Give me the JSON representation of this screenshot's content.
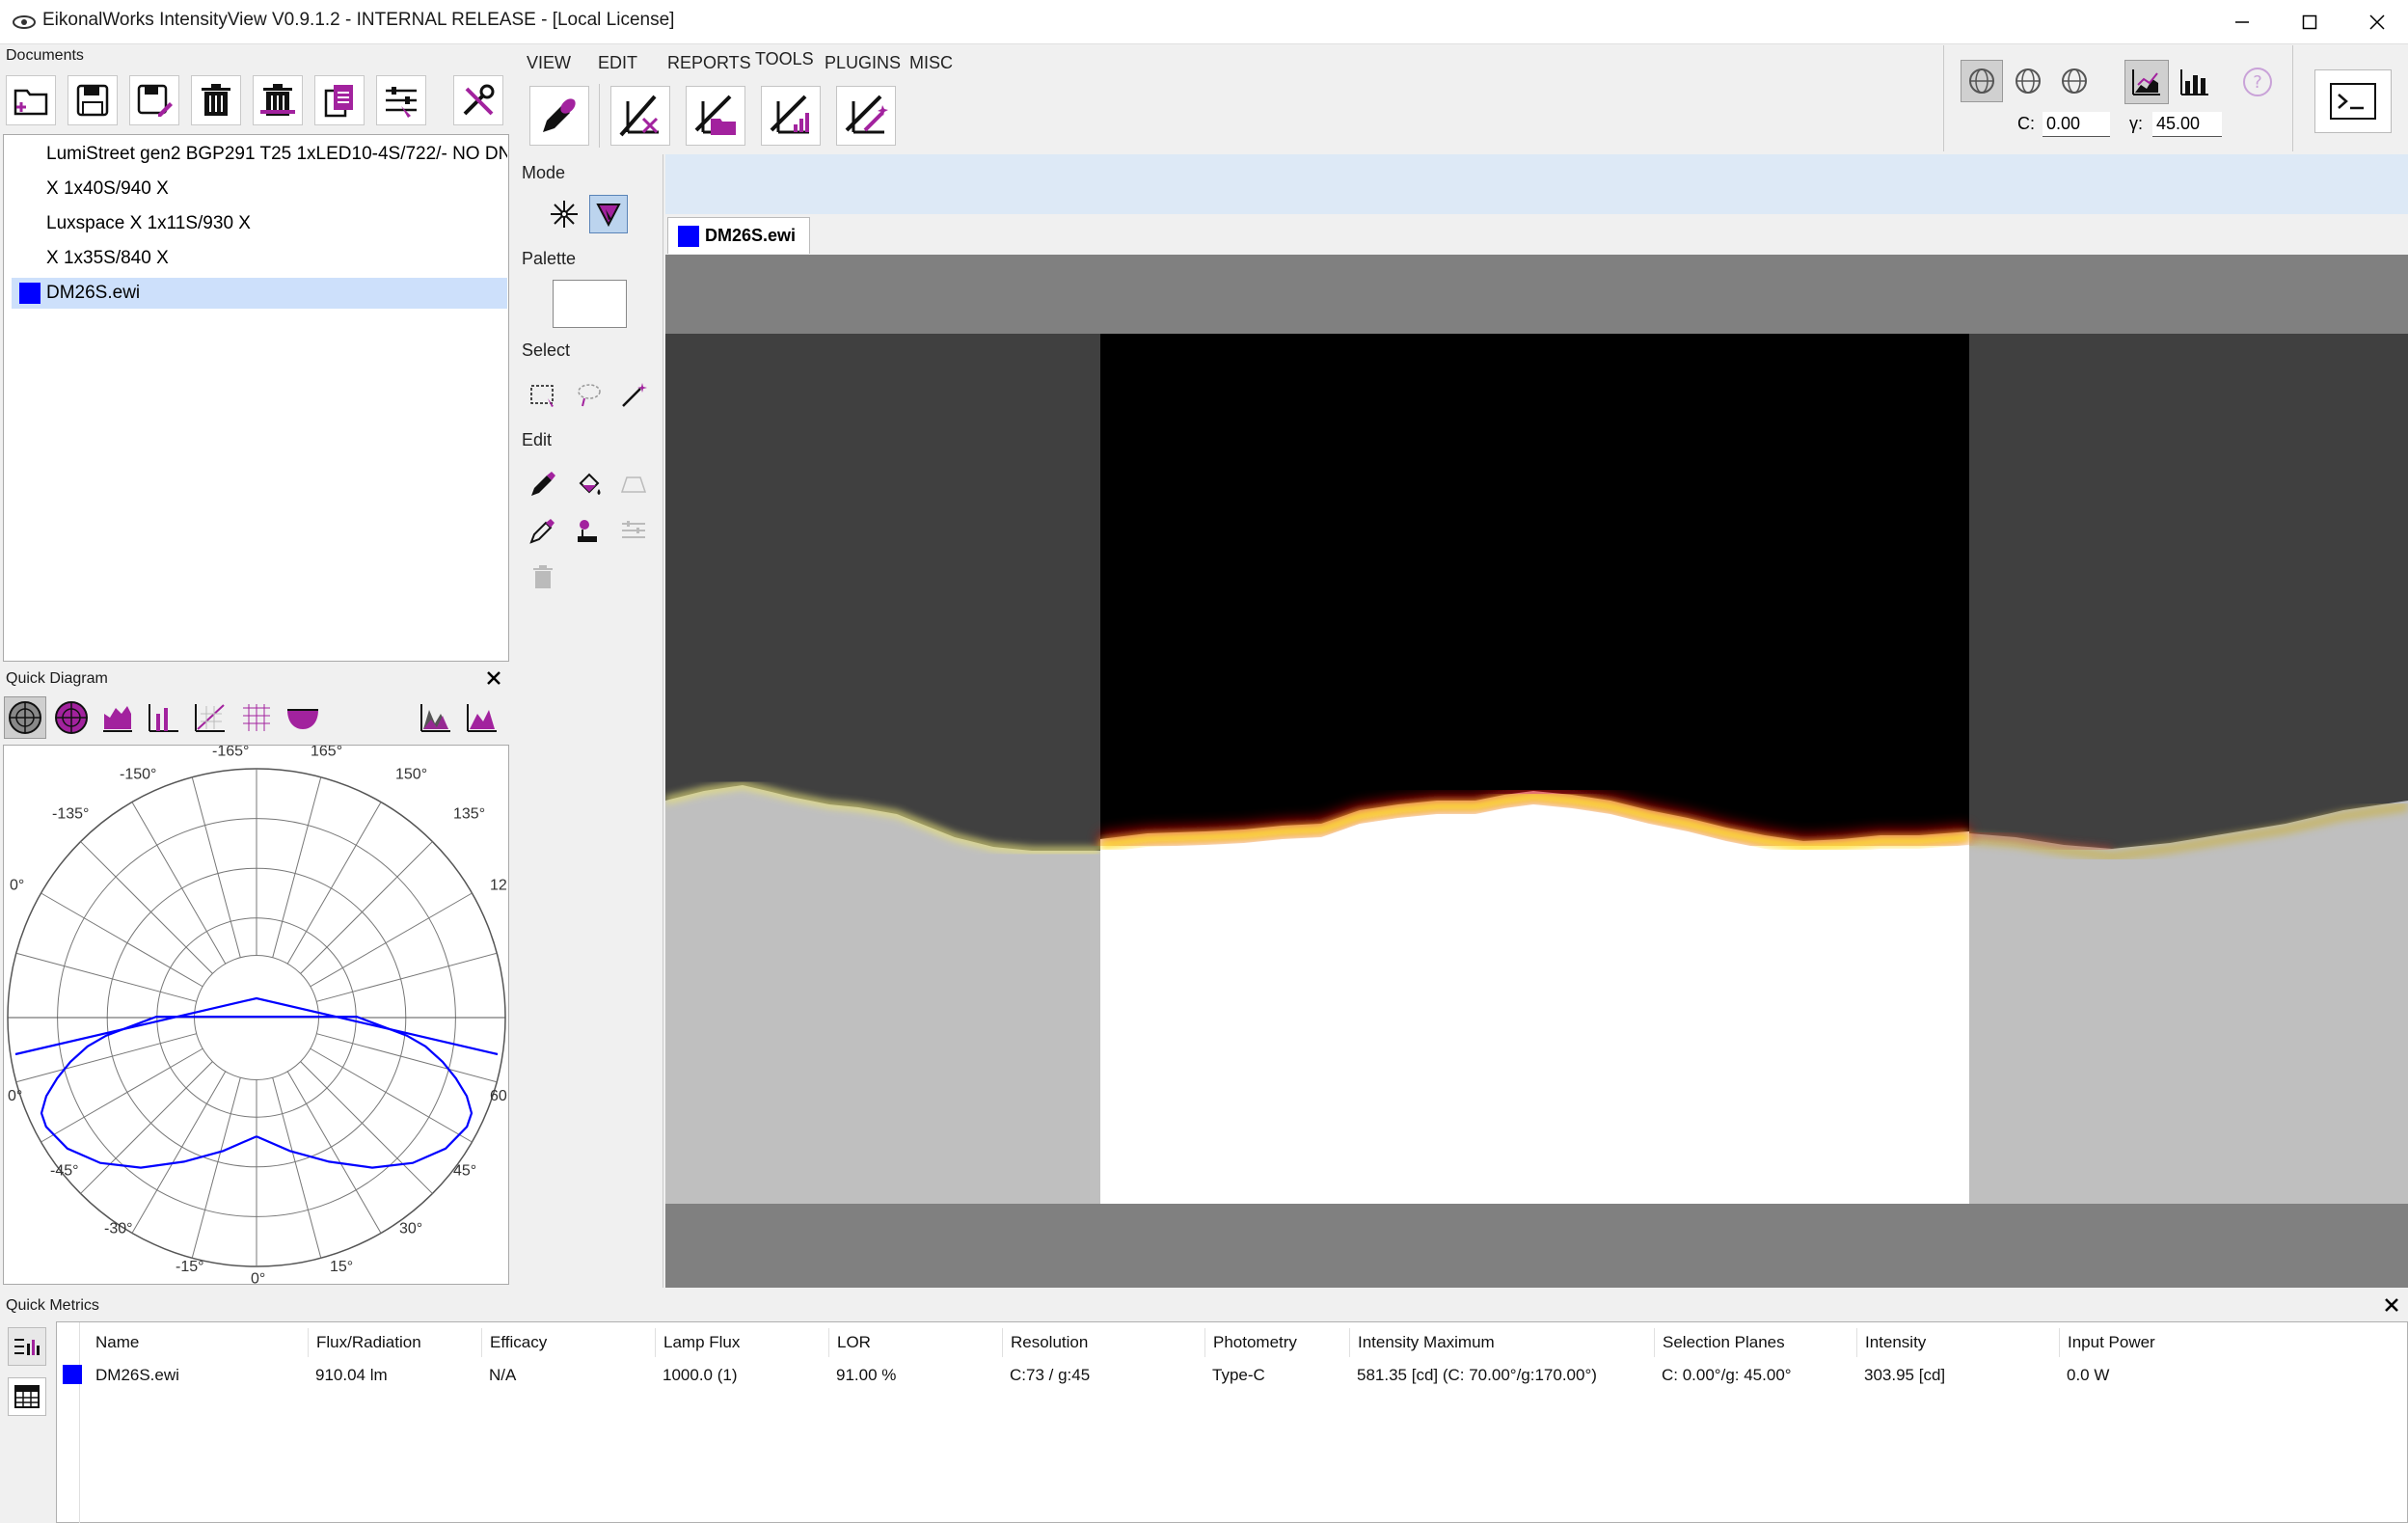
{
  "window": {
    "title": "EikonalWorks IntensityView V0.9.1.2 - INTERNAL RELEASE - [Local License]"
  },
  "documents": {
    "title": "Documents",
    "items": [
      {
        "label": "LumiStreet gen2 BGP291 T25 1xLED10-4S/722/- NO DN",
        "selected": false
      },
      {
        "label": "X 1x40S/940 X",
        "selected": false
      },
      {
        "label": "Luxspace X 1x11S/930 X",
        "selected": false
      },
      {
        "label": "X 1x35S/840 X",
        "selected": false
      },
      {
        "label": "DM26S.ewi",
        "selected": true,
        "color": "#0000ff"
      }
    ]
  },
  "ribbon": {
    "tabs": [
      {
        "label": "VIEW",
        "active": false
      },
      {
        "label": "EDIT",
        "active": false
      },
      {
        "label": "REPORTS",
        "active": false
      },
      {
        "label": "TOOLS",
        "active": true
      },
      {
        "label": "PLUGINS",
        "active": false
      },
      {
        "label": "MISC",
        "active": false
      }
    ],
    "c_label": "C:",
    "c_value": "0.00",
    "y_label": "γ:",
    "y_value": "45.00"
  },
  "tools": {
    "mode_label": "Mode",
    "palette_label": "Palette",
    "select_label": "Select",
    "edit_label": "Edit"
  },
  "canvas": {
    "tab_label": "DM26S.ewi",
    "tab_color": "#0000ff"
  },
  "quick_diagram": {
    "title": "Quick Diagram",
    "angle_labels": [
      "-165°",
      "165°",
      "-150°",
      "150°",
      "-135°",
      "135°",
      "0°",
      "12",
      "0°",
      "60",
      "-45°",
      "45°",
      "-30°",
      "30°",
      "-15°",
      "15°",
      "0°"
    ]
  },
  "quick_metrics": {
    "title": "Quick Metrics",
    "columns": [
      "Name",
      "Flux/Radiation",
      "Efficacy",
      "Lamp Flux",
      "LOR",
      "Resolution",
      "Photometry",
      "Intensity Maximum",
      "Selection Planes",
      "Intensity",
      "Input Power"
    ],
    "row": [
      "DM26S.ewi",
      "910.04 lm",
      "N/A",
      "1000.0 (1)",
      "91.00 %",
      "C:73 / g:45",
      "Type-C",
      "581.35 [cd] (C: 70.00°/g:170.00°)",
      "C: 0.00°/g: 45.00°",
      "303.95 [cd]",
      "0.0 W"
    ],
    "row_color": "#0000ff"
  },
  "colors": {
    "accent": "#a2229e",
    "selection": "#cde0fb",
    "series": "#0000ff"
  }
}
